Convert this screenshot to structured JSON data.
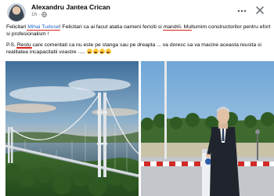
{
  "post": {
    "author": "Alexandru Jantea Crican",
    "time": "1h",
    "line1_pre": "Felicitari ",
    "mention": "Mihai Tudose",
    "line1_post": "! Felicitari ca ai facut atatia oameni fericiti si ",
    "underlined_word": "mandrii",
    "line1_end": ". Multumim constructorilor pentru efort si profesionalism !",
    "ps_pre": "P.S. ",
    "ps_underlined": "Restu",
    "ps_post": " care comentati ca nu este pe stanga sau pe dreapta ... va doresc sa va macine aceasta reusita si realitatea incapacitatii voastre .....",
    "emoji_names": [
      "rofl-emoji",
      "rofl-emoji",
      "rofl-emoji",
      "rofl-emoji"
    ]
  },
  "icons": {
    "privacy": "globe-icon",
    "more": "more-options-icon",
    "close": "close-icon"
  },
  "photos": {
    "left_subject": "bridge-photo",
    "right_subject": "speaker-photo"
  },
  "colors": {
    "mention": "#1d63c7",
    "underline": "#d9251d",
    "secondary_text": "#65676b"
  }
}
